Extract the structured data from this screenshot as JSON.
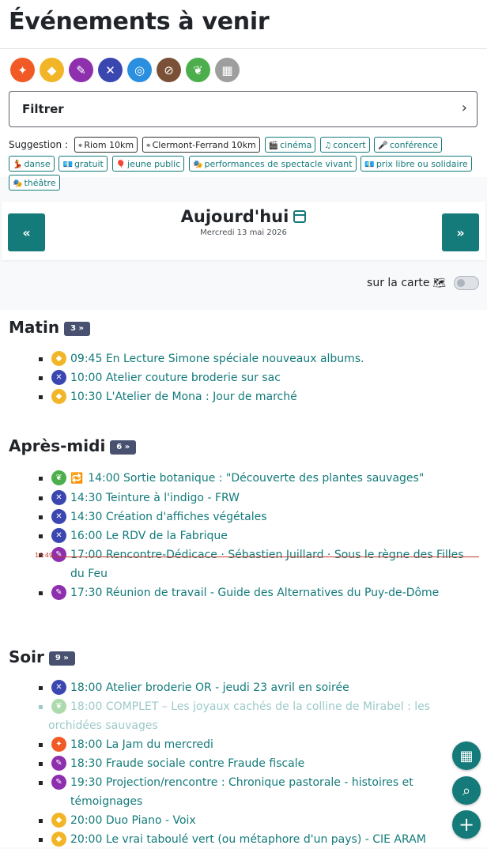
{
  "header": {
    "title": "Événements à venir",
    "categories": [
      {
        "name": "fete-icon",
        "color": "#f15a24",
        "glyph": "✦"
      },
      {
        "name": "enfants-icon",
        "color": "#f2b527",
        "glyph": "◆"
      },
      {
        "name": "arts-icon",
        "color": "#8e2fae",
        "glyph": "✎"
      },
      {
        "name": "ateliers-icon",
        "color": "#3a47b0",
        "glyph": "✕"
      },
      {
        "name": "rencontres-icon",
        "color": "#2b8fe0",
        "glyph": "◎"
      },
      {
        "name": "sorties-icon",
        "color": "#7a5136",
        "glyph": "⊘"
      },
      {
        "name": "nature-icon",
        "color": "#4cae4c",
        "glyph": "❦"
      },
      {
        "name": "calendar-cat-icon",
        "color": "#9e9e9e",
        "glyph": "▦"
      }
    ],
    "filter_label": "Filtrer",
    "filter_chevron": "›",
    "suggestion_label": "Suggestion :",
    "suggestions": [
      {
        "icon": "⌖",
        "label": "Riom 10km",
        "style": "dark"
      },
      {
        "icon": "⌖",
        "label": "Clermont-Ferrand 10km",
        "style": "dark"
      },
      {
        "icon": "🎬",
        "label": "cinéma",
        "style": "teal"
      },
      {
        "icon": "♫",
        "label": "concert",
        "style": "teal"
      },
      {
        "icon": "🎤",
        "label": "conférence",
        "style": "teal"
      },
      {
        "icon": "💃",
        "label": "danse",
        "style": "teal"
      },
      {
        "icon": "💶",
        "label": "gratuit",
        "style": "teal"
      },
      {
        "icon": "🎈",
        "label": "jeune public",
        "style": "teal"
      },
      {
        "icon": "🎭",
        "label": "performances de spectacle vivant",
        "style": "teal"
      },
      {
        "icon": "💶",
        "label": "prix libre ou solidaire",
        "style": "teal"
      },
      {
        "icon": "🎭",
        "label": "théâtre",
        "style": "teal"
      }
    ]
  },
  "nav": {
    "prev": "«",
    "next": "»",
    "today": "Aujourd'hui",
    "date": "Mercredi 13 mai 2026"
  },
  "map": {
    "label": "sur la carte",
    "icon": "🗺"
  },
  "now": "16:49",
  "sections": [
    {
      "title": "Matin",
      "count": "3 »",
      "events": [
        {
          "icon": "yellow",
          "time": "09:45",
          "text": "En Lecture Simone spéciale nouveaux albums."
        },
        {
          "icon": "indigo",
          "time": "10:00",
          "text": "Atelier couture broderie sur sac"
        },
        {
          "icon": "yellow",
          "time": "10:30",
          "text": "L'Atelier de Mona : Jour de marché"
        }
      ]
    },
    {
      "title": "Après-midi",
      "count": "6 »",
      "events": [
        {
          "icon": "green",
          "repeat": "🔁",
          "time": "14:00",
          "text": "Sortie botanique : \"Découverte des plantes sauvages\""
        },
        {
          "icon": "indigo",
          "time": "14:30",
          "text": "Teinture à l'indigo - FRW"
        },
        {
          "icon": "indigo",
          "time": "14:30",
          "text": "Création d'affiches végétales"
        },
        {
          "icon": "indigo",
          "time": "16:00",
          "text": "Le RDV de la Fabrique"
        },
        {
          "icon": "purple",
          "time": "17:00",
          "text": "Rencontre-Dédicace · Sébastien Juillard · Sous le règne des Filles du Feu"
        },
        {
          "icon": "purple",
          "time": "17:30",
          "text": "Réunion de travail - Guide des Alternatives du Puy-de-Dôme"
        }
      ]
    },
    {
      "title": "Soir",
      "count": "9 »",
      "events": [
        {
          "icon": "indigo",
          "time": "18:00",
          "text": "Atelier broderie OR - jeudi 23 avril en soirée"
        },
        {
          "icon": "green",
          "faded": true,
          "time": "18:00",
          "text": "COMPLET – Les joyaux cachés de la colline de Mirabel : les orchidées sauvages"
        },
        {
          "icon": "orange",
          "time": "18:00",
          "text": "La Jam du mercredi"
        },
        {
          "icon": "purple",
          "time": "18:30",
          "text": "Fraude sociale contre Fraude fiscale"
        },
        {
          "icon": "purple",
          "time": "19:30",
          "text": "Projection/rencontre : Chronique pastorale - histoires et témoignages"
        },
        {
          "icon": "yellow",
          "time": "20:00",
          "text": "Duo Piano - Voix"
        },
        {
          "icon": "yellow",
          "time": "20:00",
          "text": "Le vrai taboulé vert (ou métaphore d'un pays) - CIE ARAM"
        }
      ]
    }
  ],
  "fabs": [
    {
      "name": "calendar-fab",
      "glyph": "▦"
    },
    {
      "name": "search-fab",
      "glyph": "⌕"
    },
    {
      "name": "add-fab",
      "glyph": "+"
    }
  ]
}
